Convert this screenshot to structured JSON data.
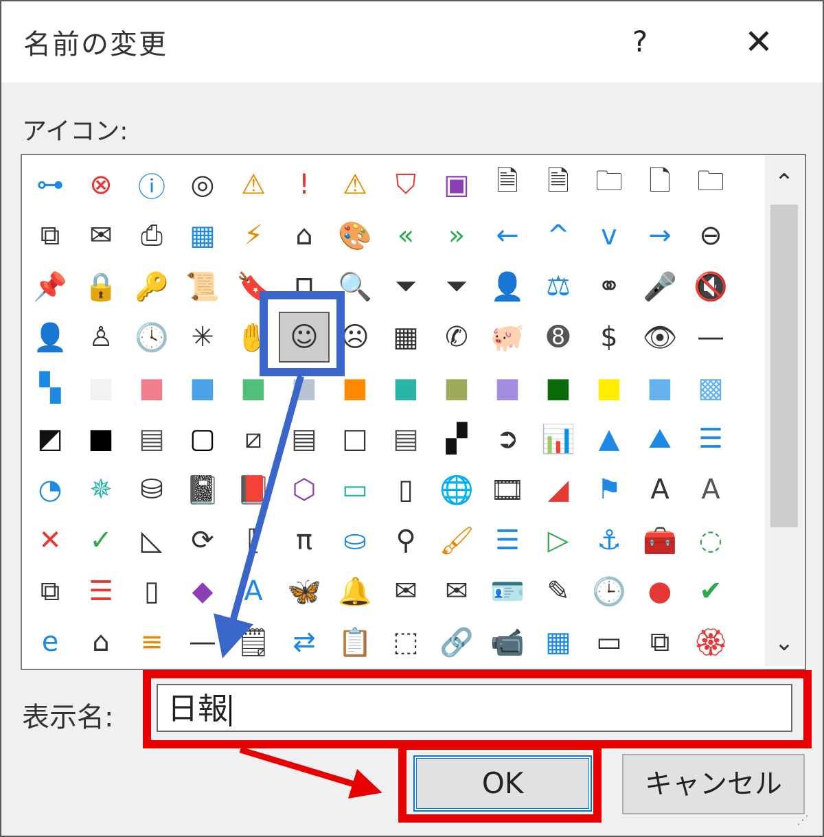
{
  "dialog": {
    "title": "名前の変更",
    "help": "?",
    "close": "✕",
    "icon_label": "アイコン:",
    "display_name_label": "表示名:",
    "display_name_value": "日報",
    "ok_label": "OK",
    "cancel_label": "キャンセル"
  },
  "scroll": {
    "up": "⌃",
    "down": "⌄"
  },
  "colors": {
    "red": "#e60000",
    "blue_highlight": "#3a66c9",
    "focus_blue": "#0078d7",
    "icon_blue": "#1e88e5",
    "warn_orange": "#e88a00",
    "green": "#2fa84f",
    "purple": "#8c3fb4"
  },
  "icons": [
    {
      "name": "org-chart-icon",
      "glyph": "⊶",
      "color": "#1e88e5"
    },
    {
      "name": "error-circle-icon",
      "glyph": "⊗",
      "color": "#e53935"
    },
    {
      "name": "info-circle-icon",
      "glyph": "ⓘ",
      "color": "#1e88e5"
    },
    {
      "name": "target-icon",
      "glyph": "◎",
      "color": "#333333"
    },
    {
      "name": "warning-icon",
      "glyph": "⚠",
      "color": "#e88a00"
    },
    {
      "name": "exclamation-icon",
      "glyph": "!",
      "color": "#e53935"
    },
    {
      "name": "warning-icon-2",
      "glyph": "⚠",
      "color": "#e88a00"
    },
    {
      "name": "shield-icon",
      "glyph": "⛉",
      "color": "#e53935"
    },
    {
      "name": "save-disk-icon",
      "glyph": "▣",
      "color": "#8c3fb4"
    },
    {
      "name": "document-export-icon",
      "glyph": "🗎",
      "color": "#333333"
    },
    {
      "name": "document-import-icon",
      "glyph": "🗎",
      "color": "#333333"
    },
    {
      "name": "folder-icon",
      "glyph": "🗀",
      "color": "#333333"
    },
    {
      "name": "blank-document-icon",
      "glyph": "🗋",
      "color": "#333333"
    },
    {
      "name": "folder-icon-2",
      "glyph": "🗀",
      "color": "#333333"
    },
    {
      "name": "copy-icon",
      "glyph": "⧉",
      "color": "#333333"
    },
    {
      "name": "mail-stack-icon",
      "glyph": "✉",
      "color": "#333333"
    },
    {
      "name": "printer-icon",
      "glyph": "⎙",
      "color": "#333333"
    },
    {
      "name": "picture-icon",
      "glyph": "▦",
      "color": "#1e88e5"
    },
    {
      "name": "flash-document-icon",
      "glyph": "⚡",
      "color": "#e88a00"
    },
    {
      "name": "home-icon",
      "glyph": "⌂",
      "color": "#333333"
    },
    {
      "name": "palette-icon",
      "glyph": "🎨",
      "color": "#333333"
    },
    {
      "name": "double-left-arrow-icon",
      "glyph": "«",
      "color": "#2fa84f"
    },
    {
      "name": "double-right-arrow-icon",
      "glyph": "»",
      "color": "#2fa84f"
    },
    {
      "name": "left-arrow-icon",
      "glyph": "←",
      "color": "#1e88e5"
    },
    {
      "name": "chevron-up-icon",
      "glyph": "^",
      "color": "#1e88e5"
    },
    {
      "name": "chevron-down-icon",
      "glyph": "v",
      "color": "#1e88e5"
    },
    {
      "name": "right-arrow-icon",
      "glyph": "→",
      "color": "#1e88e5"
    },
    {
      "name": "back-circle-icon",
      "glyph": "⊖",
      "color": "#333333"
    },
    {
      "name": "pin-icon",
      "glyph": "📌",
      "color": "#333333"
    },
    {
      "name": "lock-icon",
      "glyph": "🔒",
      "color": "#333333"
    },
    {
      "name": "key-icon",
      "glyph": "🔑",
      "color": "#333333"
    },
    {
      "name": "scroll-icon",
      "glyph": "📜",
      "color": "#333333"
    },
    {
      "name": "bookmark-icon",
      "glyph": "🔖",
      "color": "#333333"
    },
    {
      "name": "presentation-board-icon",
      "glyph": "⊓",
      "color": "#333333"
    },
    {
      "name": "magnifier-icon",
      "glyph": "🔍",
      "color": "#333333"
    },
    {
      "name": "filter-icon",
      "glyph": "⏷",
      "color": "#333333"
    },
    {
      "name": "filter-icon-2",
      "glyph": "⏷",
      "color": "#333333"
    },
    {
      "name": "contact-card-icon",
      "glyph": "👤",
      "color": "#333333"
    },
    {
      "name": "scales-icon",
      "glyph": "⚖",
      "color": "#1e88e5"
    },
    {
      "name": "overlap-circles-icon",
      "glyph": "⚭",
      "color": "#333333"
    },
    {
      "name": "microphone-icon",
      "glyph": "🎤",
      "color": "#1e88e5"
    },
    {
      "name": "mute-speaker-icon",
      "glyph": "🔇",
      "color": "#333333"
    },
    {
      "name": "person-filled-icon",
      "glyph": "👤",
      "color": "#333333"
    },
    {
      "name": "person-outline-icon",
      "glyph": "♙",
      "color": "#333333"
    },
    {
      "name": "clock-icon",
      "glyph": "🕓",
      "color": "#333333"
    },
    {
      "name": "sparkle-icon",
      "glyph": "✳",
      "color": "#333333"
    },
    {
      "name": "hand-icon",
      "glyph": "✋",
      "color": "#333333"
    },
    {
      "name": "smiley-icon",
      "glyph": "☺",
      "color": "#333333",
      "selected": true
    },
    {
      "name": "sad-face-icon",
      "glyph": "☹",
      "color": "#333333"
    },
    {
      "name": "calculator-icon",
      "glyph": "▦",
      "color": "#333333"
    },
    {
      "name": "phone-icon",
      "glyph": "✆",
      "color": "#333333"
    },
    {
      "name": "piggy-bank-icon",
      "glyph": "🐖",
      "color": "#333333"
    },
    {
      "name": "eight-ball-icon",
      "glyph": "➑",
      "color": "#555555"
    },
    {
      "name": "dollar-quote-icon",
      "glyph": "$",
      "color": "#333333"
    },
    {
      "name": "eye-icon",
      "glyph": "👁",
      "color": "#333333"
    },
    {
      "name": "dash-icon",
      "glyph": "—",
      "color": "#333333"
    },
    {
      "name": "color-grid-icon",
      "glyph": "▚",
      "color": "#1e88e5"
    },
    {
      "name": "swatch-white-icon",
      "glyph": "■",
      "color": "#f2f2f2"
    },
    {
      "name": "swatch-pink-icon",
      "glyph": "■",
      "color": "#f07d8c"
    },
    {
      "name": "swatch-blue-icon",
      "glyph": "■",
      "color": "#4aa3e8"
    },
    {
      "name": "swatch-green-icon",
      "glyph": "■",
      "color": "#4fbf7a"
    },
    {
      "name": "swatch-gray-blue-icon",
      "glyph": "■",
      "color": "#b8c4d2"
    },
    {
      "name": "swatch-orange-icon",
      "glyph": "■",
      "color": "#ff8a00"
    },
    {
      "name": "swatch-teal-icon",
      "glyph": "■",
      "color": "#2bb5a8"
    },
    {
      "name": "swatch-olive-icon",
      "glyph": "■",
      "color": "#9eab5b"
    },
    {
      "name": "swatch-lavender-icon",
      "glyph": "■",
      "color": "#a38de0"
    },
    {
      "name": "swatch-dark-green-icon",
      "glyph": "■",
      "color": "#0a6b0a"
    },
    {
      "name": "swatch-yellow-icon",
      "glyph": "■",
      "color": "#ffee00"
    },
    {
      "name": "swatch-sky-icon",
      "glyph": "■",
      "color": "#66b2ee"
    },
    {
      "name": "swatch-pattern-icon",
      "glyph": "▩",
      "color": "#66b2ee"
    },
    {
      "name": "diagonal-split-icon",
      "glyph": "◩",
      "color": "#111111"
    },
    {
      "name": "swatch-black-icon",
      "glyph": "■",
      "color": "#000000"
    },
    {
      "name": "gradient-gray-icon",
      "glyph": "▤",
      "color": "#555555"
    },
    {
      "name": "black-frame-icon",
      "glyph": "▢",
      "color": "#000000"
    },
    {
      "name": "diagonal-line-box-icon",
      "glyph": "⧄",
      "color": "#333333"
    },
    {
      "name": "gradient-bands-icon",
      "glyph": "▤",
      "color": "#444444"
    },
    {
      "name": "white-square-icon",
      "glyph": "□",
      "color": "#333333"
    },
    {
      "name": "gradient-stripes-icon",
      "glyph": "▤",
      "color": "#555555"
    },
    {
      "name": "checkerboard-icon",
      "glyph": "▞",
      "color": "#111111"
    },
    {
      "name": "arrow-circle-icon",
      "glyph": "➲",
      "color": "#333333"
    },
    {
      "name": "bar-chart-icon",
      "glyph": "📊",
      "color": "#1e88e5"
    },
    {
      "name": "cone-icon",
      "glyph": "▲",
      "color": "#1e88e5"
    },
    {
      "name": "mountain-chart-icon",
      "glyph": "⛰",
      "color": "#1e88e5"
    },
    {
      "name": "stacked-bars-icon",
      "glyph": "☰",
      "color": "#1e88e5"
    },
    {
      "name": "pie-chart-icon",
      "glyph": "◔",
      "color": "#1e88e5"
    },
    {
      "name": "radar-chart-icon",
      "glyph": "✵",
      "color": "#2bb5a8"
    },
    {
      "name": "database-icon",
      "glyph": "⛁",
      "color": "#333333"
    },
    {
      "name": "notebook-icon",
      "glyph": "📓",
      "color": "#333333"
    },
    {
      "name": "notebook-red-icon",
      "glyph": "📕",
      "color": "#e53935"
    },
    {
      "name": "cube-document-icon",
      "glyph": "⬡",
      "color": "#8c3fb4"
    },
    {
      "name": "landscape-icon",
      "glyph": "▭",
      "color": "#2bb5a8"
    },
    {
      "name": "ring-binder-icon",
      "glyph": "▯",
      "color": "#333333"
    },
    {
      "name": "web-image-icon",
      "glyph": "🌐",
      "color": "#1e88e5"
    },
    {
      "name": "video-frame-icon",
      "glyph": "🎞",
      "color": "#333333"
    },
    {
      "name": "color-slide-icon",
      "glyph": "◢",
      "color": "#e53935"
    },
    {
      "name": "flags-icon",
      "glyph": "⚑",
      "color": "#1e88e5"
    },
    {
      "name": "letter-a-box-icon",
      "glyph": "A",
      "color": "#333333"
    },
    {
      "name": "letter-a-gray-icon",
      "glyph": "A",
      "color": "#555555"
    },
    {
      "name": "cross-red-icon",
      "glyph": "✕",
      "color": "#e53935"
    },
    {
      "name": "checkmark-icon",
      "glyph": "✓",
      "color": "#2fa84f"
    },
    {
      "name": "set-square-icon",
      "glyph": "◺",
      "color": "#333333"
    },
    {
      "name": "refresh-icon",
      "glyph": "⟳",
      "color": "#333333"
    },
    {
      "name": "variable-bracket-icon",
      "glyph": "⟦",
      "color": "#333333"
    },
    {
      "name": "pi-icon",
      "glyph": "π",
      "color": "#333333"
    },
    {
      "name": "paint-bucket-icon",
      "glyph": "⛀",
      "color": "#1e88e5"
    },
    {
      "name": "search-icon",
      "glyph": "⚲",
      "color": "#333333"
    },
    {
      "name": "brush-icon",
      "glyph": "🖌",
      "color": "#e88a00"
    },
    {
      "name": "bullet-list-icon",
      "glyph": "☰",
      "color": "#1e88e5"
    },
    {
      "name": "play-triangle-icon",
      "glyph": "▷",
      "color": "#2fa84f"
    },
    {
      "name": "anchor-icon",
      "glyph": "⚓",
      "color": "#1e88e5"
    },
    {
      "name": "toolbox-icon",
      "glyph": "🧰",
      "color": "#333333"
    },
    {
      "name": "dotted-circle-add-icon",
      "glyph": "◌",
      "color": "#2fa84f"
    },
    {
      "name": "layers-icon",
      "glyph": "⧉",
      "color": "#333333"
    },
    {
      "name": "list-alert-icon",
      "glyph": "☰",
      "color": "#e53935"
    },
    {
      "name": "notebook-tabs-icon",
      "glyph": "▯",
      "color": "#333333"
    },
    {
      "name": "eraser-icon",
      "glyph": "◆",
      "color": "#8c3fb4"
    },
    {
      "name": "script-a-icon",
      "glyph": "A",
      "color": "#1e88e5"
    },
    {
      "name": "butterfly-logo-icon",
      "glyph": "🦋",
      "color": "#e53935"
    },
    {
      "name": "bell-icon",
      "glyph": "🔔",
      "color": "#333333"
    },
    {
      "name": "open-envelope-icon",
      "glyph": "✉",
      "color": "#333333"
    },
    {
      "name": "envelope-icon",
      "glyph": "✉",
      "color": "#333333"
    },
    {
      "name": "id-card-icon",
      "glyph": "🪪",
      "color": "#333333"
    },
    {
      "name": "edit-card-icon",
      "glyph": "✎",
      "color": "#333333"
    },
    {
      "name": "clock-orange-icon",
      "glyph": "🕒",
      "color": "#e88a00"
    },
    {
      "name": "red-circle-icon",
      "glyph": "●",
      "color": "#e53935"
    },
    {
      "name": "green-check-circle-icon",
      "glyph": "✔",
      "color": "#2fa84f"
    },
    {
      "name": "ie-logo-icon",
      "glyph": "e",
      "color": "#1e88e5"
    },
    {
      "name": "home-small-icon",
      "glyph": "⌂",
      "color": "#333333"
    },
    {
      "name": "stack-orange-icon",
      "glyph": "≡",
      "color": "#e88a00"
    },
    {
      "name": "horizontal-line-icon",
      "glyph": "—",
      "color": "#333333"
    },
    {
      "name": "note-icon",
      "glyph": "🗒",
      "color": "#333333"
    },
    {
      "name": "document-swap-icon",
      "glyph": "⇄",
      "color": "#1e88e5"
    },
    {
      "name": "clipboard-icon",
      "glyph": "📋",
      "color": "#333333"
    },
    {
      "name": "box-icon",
      "glyph": "⬚",
      "color": "#333333"
    },
    {
      "name": "link-check-icon",
      "glyph": "🔗",
      "color": "#2fa84f"
    },
    {
      "name": "video-camera-icon",
      "glyph": "📹",
      "color": "#333333"
    },
    {
      "name": "table-grid-icon",
      "glyph": "▦",
      "color": "#1e88e5"
    },
    {
      "name": "window-icon",
      "glyph": "▭",
      "color": "#333333"
    },
    {
      "name": "windows-stack-icon",
      "glyph": "⧉",
      "color": "#333333"
    },
    {
      "name": "certificate-icon",
      "glyph": "🏵",
      "color": "#e53935"
    }
  ]
}
